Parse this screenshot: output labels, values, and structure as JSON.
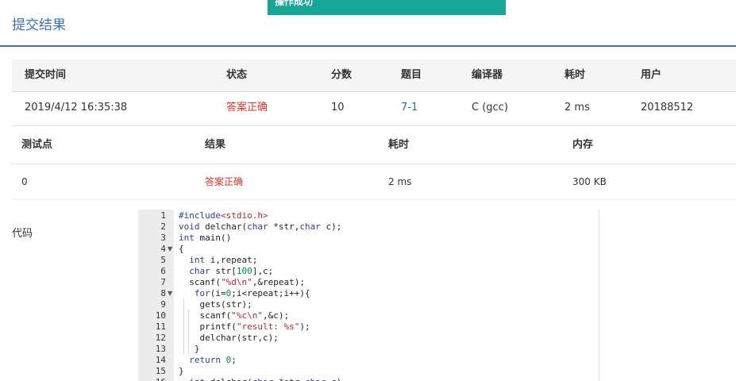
{
  "toast": {
    "text": "操作成功"
  },
  "page_title": "提交结果",
  "summary": {
    "headers": [
      "提交时间",
      "状态",
      "分数",
      "题目",
      "编译器",
      "耗时",
      "用户"
    ],
    "row": {
      "time": "2019/4/12 16:35:38",
      "status": "答案正确",
      "score": "10",
      "problem": "7-1",
      "compiler": "C (gcc)",
      "elapsed": "2 ms",
      "user": "20188512"
    }
  },
  "testpoints": {
    "headers": [
      "测试点",
      "结果",
      "耗时",
      "内存"
    ],
    "row": {
      "id": "0",
      "result": "答案正确",
      "time": "2 ms",
      "memory": "300 KB"
    }
  },
  "code_label": "代码",
  "code_lines": [
    "#include<stdio.h>",
    "void delchar(char *str,char c);",
    "int main()",
    "{",
    "  int i,repeat;",
    "  char str[100],c;",
    "  scanf(\"%d\\n\",&repeat);",
    "  for(i=0;i<repeat;i++){",
    "    gets(str);",
    "    scanf(\"%c\\n\",&c);",
    "    printf(\"result: %s\");",
    "    delchar(str,c);",
    "  }",
    "  return 0;",
    "}",
    "  int delchar(char *str,char c)"
  ],
  "colors": {
    "accent": "#3d6fb6",
    "success_red": "#d9362d",
    "toast_bg": "#16a597"
  }
}
